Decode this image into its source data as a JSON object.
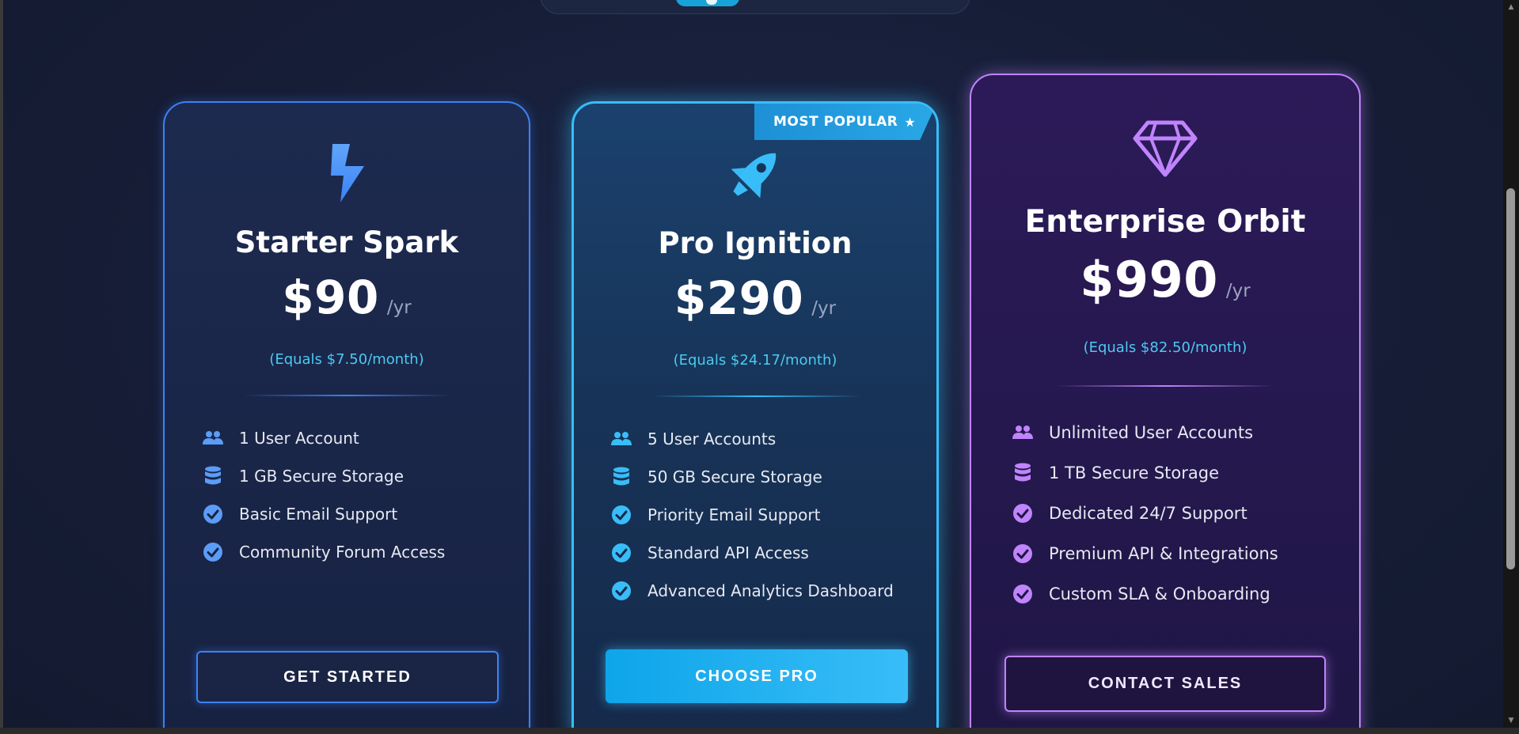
{
  "badge": {
    "label": "MOST POPULAR",
    "icon": "star-icon"
  },
  "plans": [
    {
      "name": "Starter Spark",
      "price": "$90",
      "period": "/yr",
      "equals": "(Equals $7.50/month)",
      "icon": "lightning-bolt-icon",
      "accent": "#3b82f6",
      "features": [
        {
          "icon": "users-icon",
          "text": "1 User Account"
        },
        {
          "icon": "database-icon",
          "text": "1 GB Secure Storage"
        },
        {
          "icon": "check-circle-icon",
          "text": "Basic Email Support"
        },
        {
          "icon": "check-circle-icon",
          "text": "Community Forum Access"
        }
      ],
      "button": "GET STARTED"
    },
    {
      "name": "Pro Ignition",
      "price": "$290",
      "period": "/yr",
      "equals": "(Equals $24.17/month)",
      "icon": "rocket-icon",
      "accent": "#38bdf8",
      "features": [
        {
          "icon": "users-icon",
          "text": "5 User Accounts"
        },
        {
          "icon": "database-icon",
          "text": "50 GB Secure Storage"
        },
        {
          "icon": "check-circle-icon",
          "text": "Priority Email Support"
        },
        {
          "icon": "check-circle-icon",
          "text": "Standard API Access"
        },
        {
          "icon": "check-circle-icon",
          "text": "Advanced Analytics Dashboard"
        }
      ],
      "button": "CHOOSE PRO"
    },
    {
      "name": "Enterprise Orbit",
      "price": "$990",
      "period": "/yr",
      "equals": "(Equals $82.50/month)",
      "icon": "diamond-icon",
      "accent": "#c084fc",
      "features": [
        {
          "icon": "users-icon",
          "text": "Unlimited User Accounts"
        },
        {
          "icon": "database-icon",
          "text": "1 TB Secure Storage"
        },
        {
          "icon": "check-circle-icon",
          "text": "Dedicated 24/7 Support"
        },
        {
          "icon": "check-circle-icon",
          "text": "Premium API & Integrations"
        },
        {
          "icon": "check-circle-icon",
          "text": "Custom SLA & Onboarding"
        }
      ],
      "button": "CONTACT SALES"
    }
  ]
}
